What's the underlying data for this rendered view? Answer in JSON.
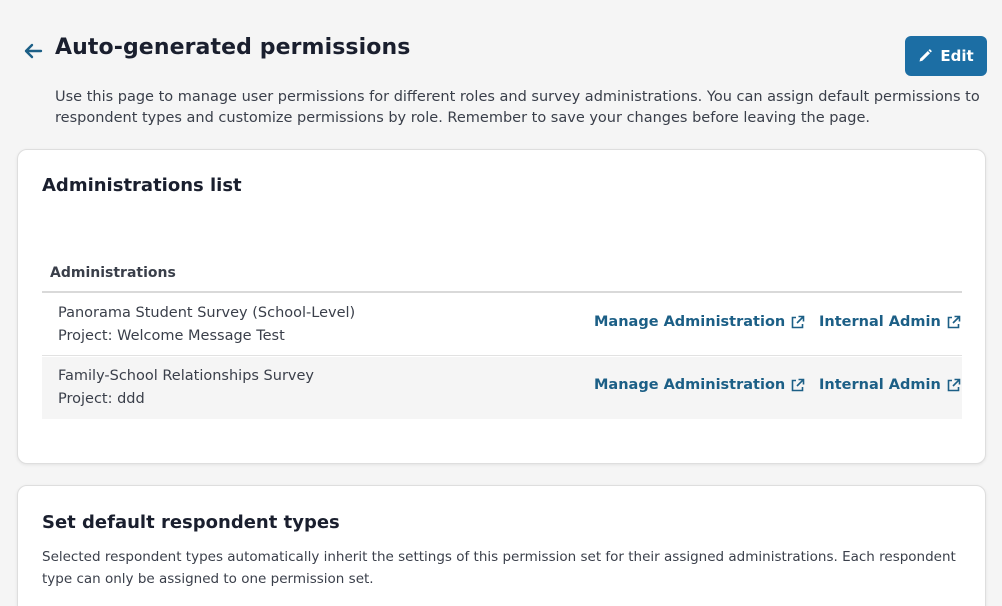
{
  "header": {
    "title": "Auto-generated permissions",
    "edit_label": "Edit",
    "description": "Use this page to manage user permissions for different roles and survey administrations. You can assign default permissions to respondent types and customize permissions by role. Remember to save your changes before leaving the page."
  },
  "administrations_card": {
    "title": "Administrations list",
    "column_header": "Administrations",
    "rows": [
      {
        "name": "Panorama Student Survey (School-Level)",
        "project": "Project: Welcome Message Test",
        "manage_label": "Manage Administration",
        "internal_label": "Internal Admin"
      },
      {
        "name": "Family-School Relationships Survey",
        "project": "Project: ddd",
        "manage_label": "Manage Administration",
        "internal_label": "Internal Admin"
      }
    ]
  },
  "respondent_card": {
    "title": "Set default respondent types",
    "description": "Selected respondent types automatically inherit the settings of this permission set for their assigned administrations. Each respondent type can only be assigned to one permission set."
  },
  "colors": {
    "accent": "#1c6ea4",
    "link": "#1c5f86",
    "background": "#f5f5f5"
  },
  "icons": {
    "back": "arrow-left-icon",
    "edit": "pencil-icon",
    "external": "external-link-icon"
  }
}
